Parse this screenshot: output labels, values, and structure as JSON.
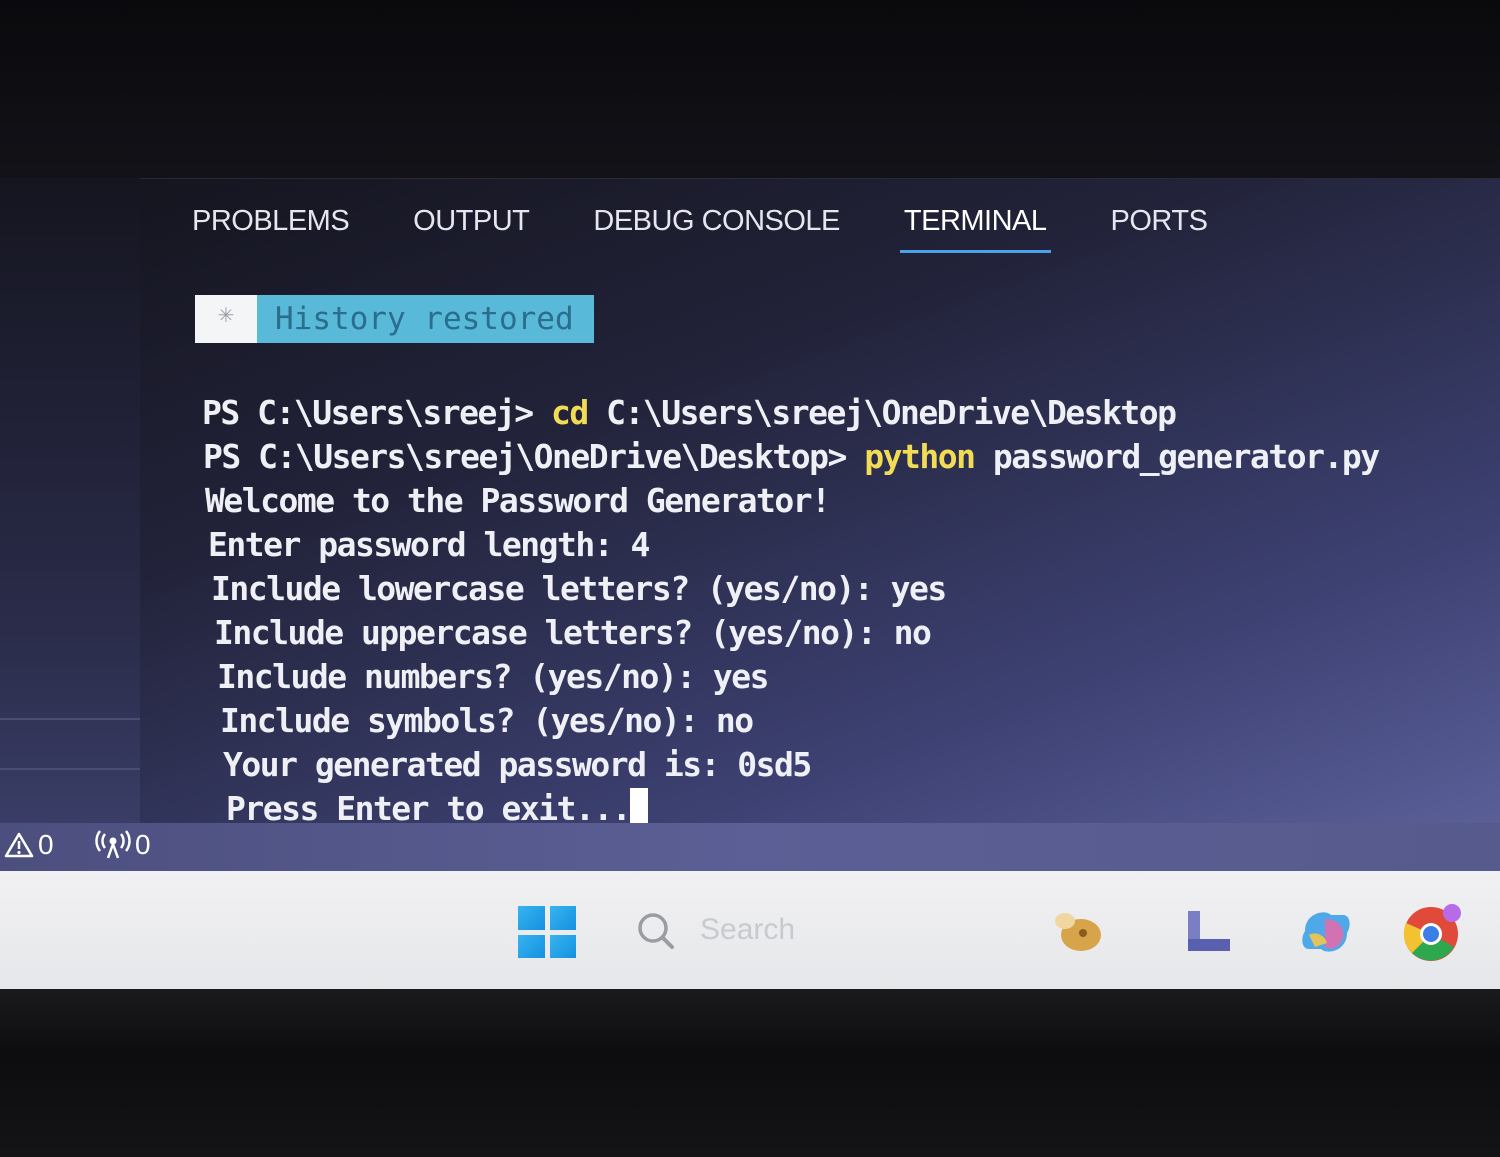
{
  "panel": {
    "tabs": [
      {
        "label": "PROBLEMS",
        "active": false
      },
      {
        "label": "OUTPUT",
        "active": false
      },
      {
        "label": "DEBUG CONSOLE",
        "active": false
      },
      {
        "label": "TERMINAL",
        "active": true
      },
      {
        "label": "PORTS",
        "active": false
      }
    ],
    "history_banner": {
      "icon": "asterisk-icon",
      "icon_glyph": "✳",
      "text": "History restored"
    }
  },
  "terminal": {
    "lines": [
      {
        "prompt": "PS C:\\Users\\sreej> ",
        "command": "cd",
        "rest": " C:\\Users\\sreej\\OneDrive\\Desktop"
      },
      {
        "prompt": "PS C:\\Users\\sreej\\OneDrive\\Desktop> ",
        "command": "python",
        "rest": " password_generator.py"
      },
      {
        "text": "Welcome to the Password Generator!"
      },
      {
        "text": "Enter password length: 4"
      },
      {
        "text": "Include lowercase letters? (yes/no): yes"
      },
      {
        "text": "Include uppercase letters? (yes/no): no"
      },
      {
        "text": "Include numbers? (yes/no): yes"
      },
      {
        "text": "Include symbols? (yes/no): no"
      },
      {
        "text": "Your generated password is: 0sd5"
      },
      {
        "text": "Press Enter to exit..."
      }
    ],
    "command_color": "#f2dc55"
  },
  "status_bar": {
    "warnings_count": "0",
    "ports_count": "0",
    "warnings_icon": "warning-icon",
    "ports_icon": "broadcast-icon"
  },
  "taskbar": {
    "search_placeholder": "Search",
    "apps": [
      "start-icon",
      "search-icon",
      "ai-app-icon",
      "launcher-app-icon",
      "copilot-icon",
      "chrome-icon"
    ]
  },
  "colors": {
    "accent_tab_underline": "#4aa3e6",
    "banner_bg": "#58b9d8"
  }
}
